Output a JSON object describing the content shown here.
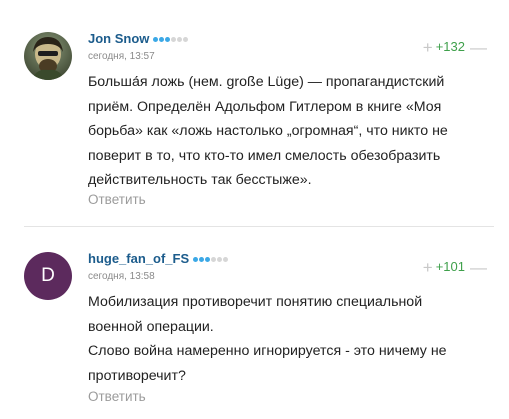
{
  "comments": [
    {
      "username": "Jon Snow",
      "rating_level": 3,
      "rating_max": 6,
      "time": "сегодня, 13:57",
      "score": "+132",
      "text_lines": [
        "Больша́я ложь (нем. große Lüge) — пропагандистский",
        "приём. Определён Адольфом Гитлером в книге «Моя",
        "борьба» как «ложь настолько „огромная“, что никто не",
        "поверит в то, что кто-то имел смелость обезобразить",
        "действительность так бесстыже»."
      ],
      "reply_label": "Ответить"
    },
    {
      "username": "huge_fan_of_FS",
      "avatar_letter": "D",
      "rating_level": 3,
      "rating_max": 6,
      "time": "сегодня, 13:58",
      "score": "+101",
      "text_lines": [
        "Мобилизация противоречит понятию специальной",
        "военной операции.",
        "Слово война намеренно игнорируется - это ничему не",
        "противоречит?"
      ],
      "reply_label": "Ответить"
    }
  ],
  "colors": {
    "username": "#1c5c8c",
    "score_positive": "#3fa04b",
    "rating_on": "#3ba8e6",
    "rating_off": "#d6d6d6",
    "avatar_bg": "#5c2a5d"
  },
  "icons": {
    "upvote": "plus-icon",
    "downvote": "minus-icon"
  }
}
